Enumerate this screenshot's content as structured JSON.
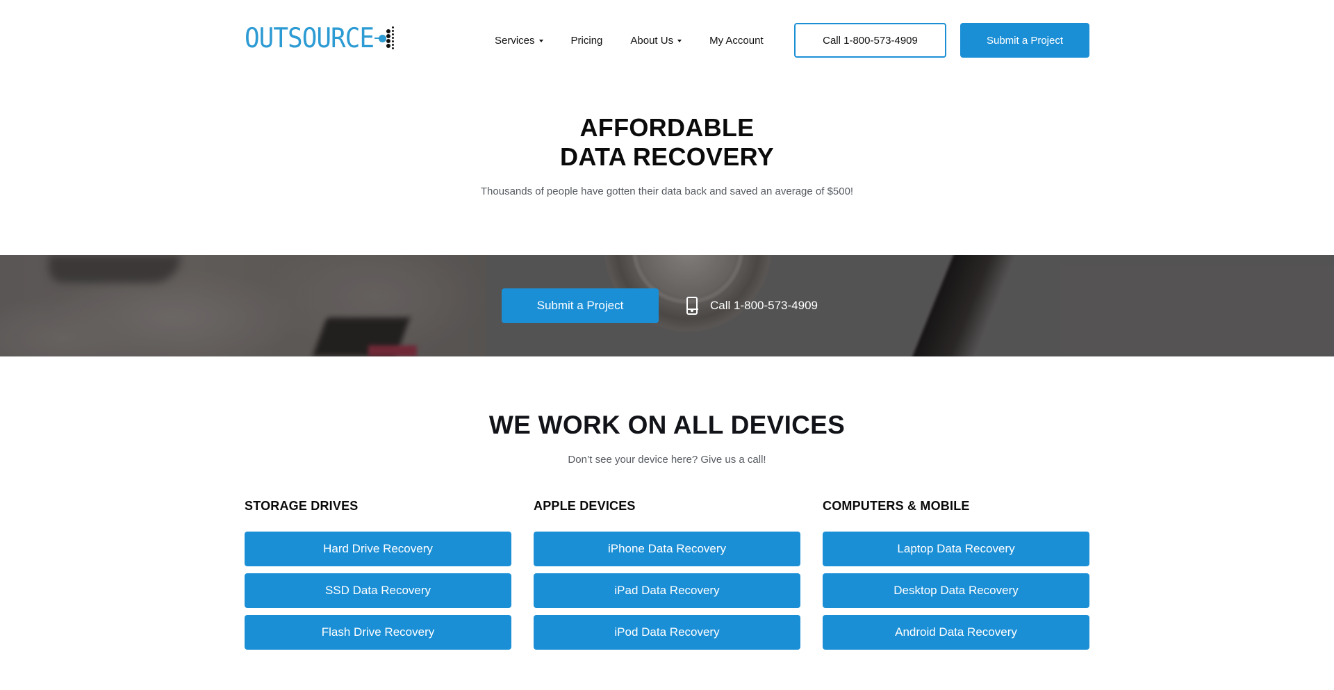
{
  "header": {
    "logo_text": "OUTSOURCE",
    "logo_icon": "data-dots-logo-mark",
    "nav": [
      {
        "label": "Services",
        "has_dropdown": true
      },
      {
        "label": "Pricing",
        "has_dropdown": false
      },
      {
        "label": "About Us",
        "has_dropdown": true
      },
      {
        "label": "My Account",
        "has_dropdown": false
      }
    ],
    "call_button": "Call 1-800-573-4909",
    "submit_button": "Submit a Project"
  },
  "hero": {
    "title_line1": "AFFORDABLE",
    "title_line2": "DATA RECOVERY",
    "subtitle": "Thousands of people have gotten their data back and saved an average of $500!"
  },
  "banner": {
    "submit_button": "Submit a Project",
    "call_icon": "mobile-phone-icon",
    "call_text": "Call 1-800-573-4909"
  },
  "devices": {
    "title": "WE WORK ON ALL DEVICES",
    "subtitle": "Don’t see your device here? Give us a call!",
    "columns": [
      {
        "title": "STORAGE DRIVES",
        "items": [
          "Hard Drive Recovery",
          "SSD Data Recovery",
          "Flash Drive Recovery"
        ]
      },
      {
        "title": "APPLE DEVICES",
        "items": [
          "iPhone Data Recovery",
          "iPad Data Recovery",
          "iPod Data Recovery"
        ]
      },
      {
        "title": "COMPUTERS & MOBILE",
        "items": [
          "Laptop Data Recovery",
          "Desktop Data Recovery",
          "Android Data Recovery"
        ]
      }
    ]
  },
  "colors": {
    "brand_blue": "#1b8fd6",
    "logo_blue": "#2d9bd3",
    "heading": "#0a0a0a",
    "body_text": "#555a60"
  }
}
